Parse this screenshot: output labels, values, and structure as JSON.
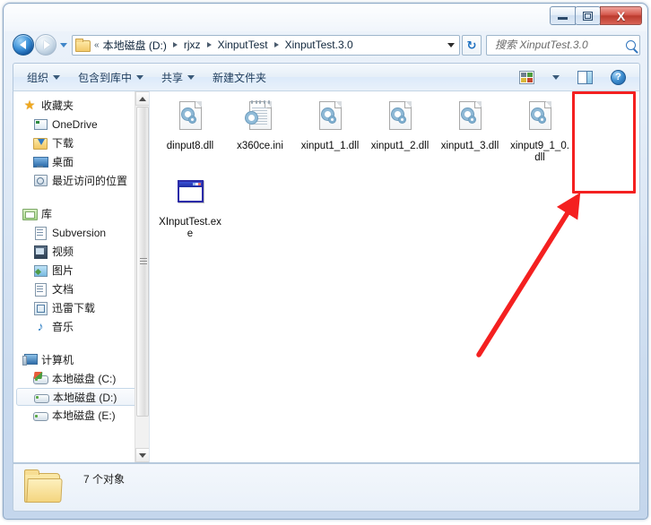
{
  "window": {
    "controls": {
      "minimize": "–",
      "maximize": "❐",
      "close": "X"
    }
  },
  "addressbar": {
    "back_label": "后退",
    "forward_label": "前进",
    "history_label": "最近的位置",
    "overflow": "«",
    "crumbs": [
      "本地磁盘 (D:)",
      "rjxz",
      "XinputTest",
      "XinputTest.3.0"
    ],
    "refresh_label": "↻",
    "dropdown_label": "▾"
  },
  "search": {
    "value": "",
    "placeholder": "搜索 XinputTest.3.0",
    "icon": "search-icon"
  },
  "toolbar": {
    "items": [
      {
        "label": "组织",
        "has_caret": true
      },
      {
        "label": "包含到库中",
        "has_caret": true
      },
      {
        "label": "共享",
        "has_caret": true
      },
      {
        "label": "新建文件夹",
        "has_caret": false
      }
    ],
    "view_icon": "view-layout-icon",
    "view_caret": "▾",
    "preview_icon": "preview-pane-icon",
    "help_icon": "help-icon",
    "help_glyph": "?"
  },
  "navpane": {
    "groups": [
      {
        "header": {
          "label": "收藏夹",
          "icon": "star-icon"
        },
        "items": [
          {
            "label": "OneDrive",
            "icon": "onedrive-icon"
          },
          {
            "label": "下载",
            "icon": "downloads-icon"
          },
          {
            "label": "桌面",
            "icon": "desktop-icon"
          },
          {
            "label": "最近访问的位置",
            "icon": "recent-places-icon"
          }
        ]
      },
      {
        "header": {
          "label": "库",
          "icon": "libraries-icon"
        },
        "items": [
          {
            "label": "Subversion",
            "icon": "subversion-icon"
          },
          {
            "label": "视频",
            "icon": "videos-icon"
          },
          {
            "label": "图片",
            "icon": "pictures-icon"
          },
          {
            "label": "文档",
            "icon": "documents-icon"
          },
          {
            "label": "迅雷下载",
            "icon": "xunlei-icon"
          },
          {
            "label": "音乐",
            "icon": "music-icon",
            "glyph": "♪"
          }
        ]
      },
      {
        "header": {
          "label": "计算机",
          "icon": "computer-icon"
        },
        "items": [
          {
            "label": "本地磁盘 (C:)",
            "icon": "drive-c-icon",
            "selected": false
          },
          {
            "label": "本地磁盘 (D:)",
            "icon": "drive-d-icon",
            "selected": true
          },
          {
            "label": "本地磁盘 (E:)",
            "icon": "drive-e-icon",
            "selected": false
          }
        ]
      }
    ],
    "scrollbar": {
      "up": "▲",
      "down": "▼"
    }
  },
  "files": [
    {
      "name": "dinput8.dll",
      "icon": "dll-file-icon"
    },
    {
      "name": "x360ce.ini",
      "icon": "ini-file-icon"
    },
    {
      "name": "xinput1_1.dll",
      "icon": "dll-file-icon"
    },
    {
      "name": "xinput1_2.dll",
      "icon": "dll-file-icon"
    },
    {
      "name": "xinput1_3.dll",
      "icon": "dll-file-icon"
    },
    {
      "name": "xinput9_1_0.dll",
      "icon": "dll-file-icon"
    },
    {
      "name": "XInputTest.exe",
      "icon": "exe-file-icon",
      "highlighted": true
    }
  ],
  "statusbar": {
    "text": "7 个对象",
    "icon": "folder-icon"
  },
  "annotations": {
    "highlight_color": "#f42020",
    "rect_target": "XInputTest.exe",
    "arrow_points_to": "XInputTest.exe"
  }
}
